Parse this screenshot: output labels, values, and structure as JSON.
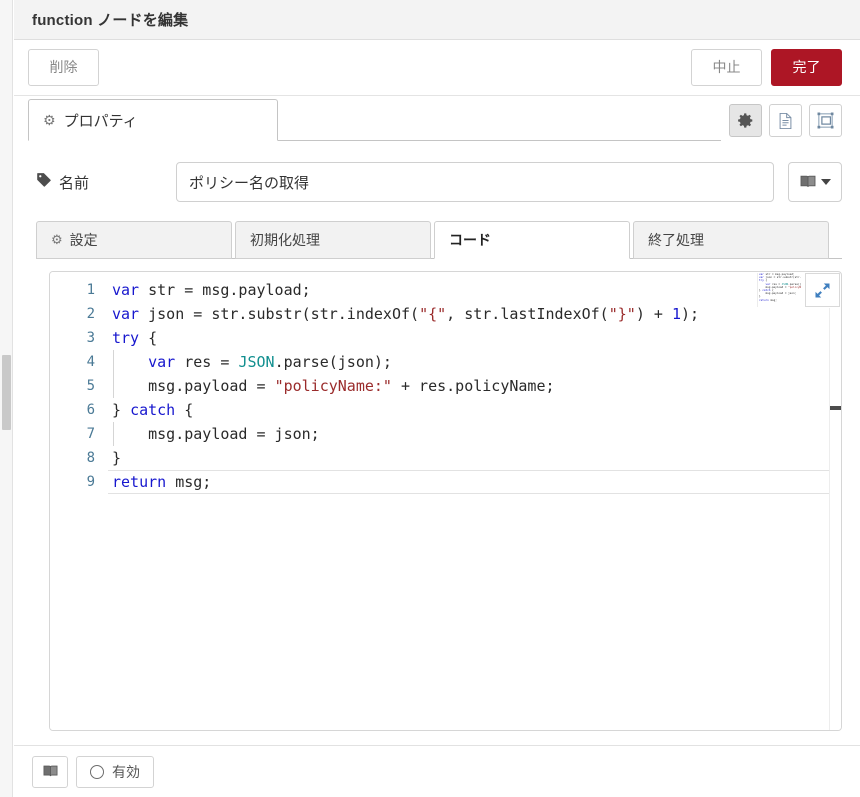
{
  "header": {
    "title": "function ノードを編集"
  },
  "actions": {
    "delete_label": "削除",
    "cancel_label": "中止",
    "done_label": "完了",
    "done_color": "#ad1625"
  },
  "main_tabs": [
    {
      "label": "プロパティ",
      "icon": "gear-icon",
      "active": true
    }
  ],
  "header_icons": [
    {
      "name": "gear-icon",
      "active": true
    },
    {
      "name": "description-icon",
      "active": false
    },
    {
      "name": "node-appearance-icon",
      "active": false
    }
  ],
  "name_row": {
    "label": "名前",
    "icon": "tag-icon",
    "value": "ポリシー名の取得",
    "placeholder": "名前",
    "library_icon": "library-book-icon"
  },
  "sub_tabs": [
    {
      "label": "設定",
      "icon": "gear-icon",
      "active": false
    },
    {
      "label": "初期化処理",
      "icon": null,
      "active": false
    },
    {
      "label": "コード",
      "icon": null,
      "active": true
    },
    {
      "label": "終了処理",
      "icon": null,
      "active": false
    }
  ],
  "editor": {
    "expand_icon": "expand-diagonal-icon",
    "active_line": 9,
    "line_numbers": [
      "1",
      "2",
      "3",
      "4",
      "5",
      "6",
      "7",
      "8",
      "9"
    ],
    "lines": [
      {
        "n": 1,
        "indent": false,
        "tokens": [
          {
            "t": "var",
            "c": "k"
          },
          {
            "t": " str = msg.payload;",
            "c": ""
          }
        ]
      },
      {
        "n": 2,
        "indent": false,
        "tokens": [
          {
            "t": "var",
            "c": "k"
          },
          {
            "t": " json = str.substr(str.indexOf(",
            "c": ""
          },
          {
            "t": "\"{\"",
            "c": "s"
          },
          {
            "t": ", str.lastIndexOf(",
            "c": ""
          },
          {
            "t": "\"}\"",
            "c": "s"
          },
          {
            "t": ") + ",
            "c": ""
          },
          {
            "t": "1",
            "c": "n"
          },
          {
            "t": ");",
            "c": ""
          }
        ]
      },
      {
        "n": 3,
        "indent": false,
        "tokens": [
          {
            "t": "try",
            "c": "k"
          },
          {
            "t": " {",
            "c": ""
          }
        ]
      },
      {
        "n": 4,
        "indent": true,
        "tokens": [
          {
            "t": "    ",
            "c": ""
          },
          {
            "t": "var",
            "c": "k"
          },
          {
            "t": " res = ",
            "c": ""
          },
          {
            "t": "JSON",
            "c": "cls"
          },
          {
            "t": ".parse(json);",
            "c": ""
          }
        ]
      },
      {
        "n": 5,
        "indent": true,
        "tokens": [
          {
            "t": "    msg.payload = ",
            "c": ""
          },
          {
            "t": "\"policyName:\"",
            "c": "s"
          },
          {
            "t": " + res.policyName;",
            "c": ""
          }
        ]
      },
      {
        "n": 6,
        "indent": false,
        "tokens": [
          {
            "t": "} ",
            "c": ""
          },
          {
            "t": "catch",
            "c": "k"
          },
          {
            "t": " {",
            "c": ""
          }
        ]
      },
      {
        "n": 7,
        "indent": true,
        "tokens": [
          {
            "t": "    msg.payload = json;",
            "c": ""
          }
        ]
      },
      {
        "n": 8,
        "indent": false,
        "tokens": [
          {
            "t": "}",
            "c": ""
          }
        ]
      },
      {
        "n": 9,
        "indent": false,
        "tokens": [
          {
            "t": "return",
            "c": "k"
          },
          {
            "t": " msg;",
            "c": ""
          }
        ]
      }
    ]
  },
  "footer": {
    "library_icon": "library-book-icon",
    "enabled_label": "有効",
    "enabled_icon": "circle-toggle-icon"
  }
}
